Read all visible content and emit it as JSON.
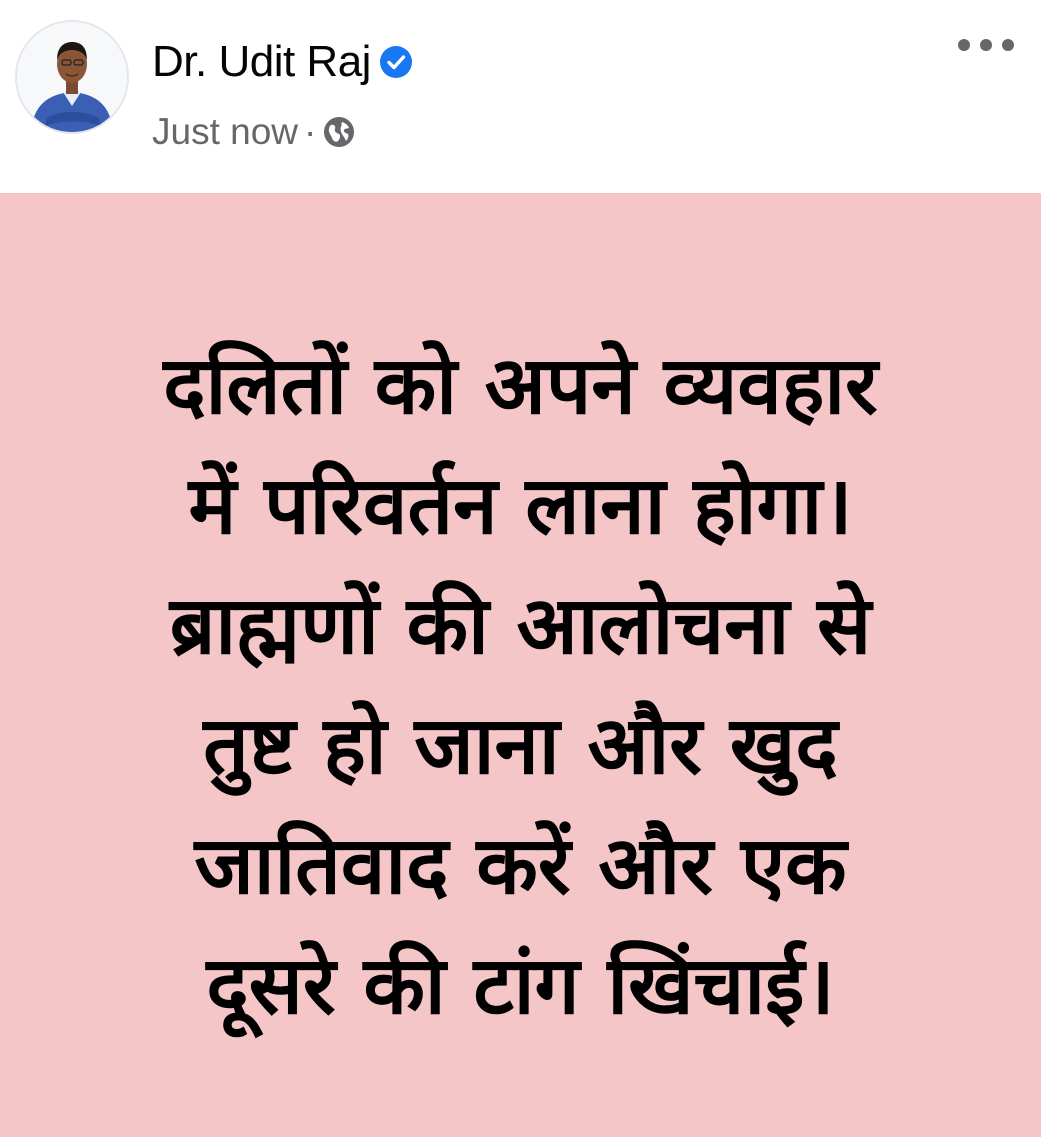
{
  "post": {
    "author": {
      "name": "Dr. Udit Raj",
      "verified_icon": "verified-badge-icon",
      "avatar_icon": "profile-avatar"
    },
    "meta": {
      "timestamp": "Just now",
      "separator": "·",
      "audience_icon": "globe-icon"
    },
    "more_options_icon": "more-options-icon",
    "background_color": "#f4c6c8",
    "text": "दलितों को अपने व्यवहार\nमें परिवर्तन लाना होगा।\nब्राह्मणों की आलोचना से\nतुष्ट हो जाना और खुद\nजातिवाद करें और एक\nदूसरे की टांग खिंचाई।"
  },
  "colors": {
    "verified_blue": "#1877f2",
    "secondary_text": "#65676b",
    "primary_text": "#050505"
  }
}
